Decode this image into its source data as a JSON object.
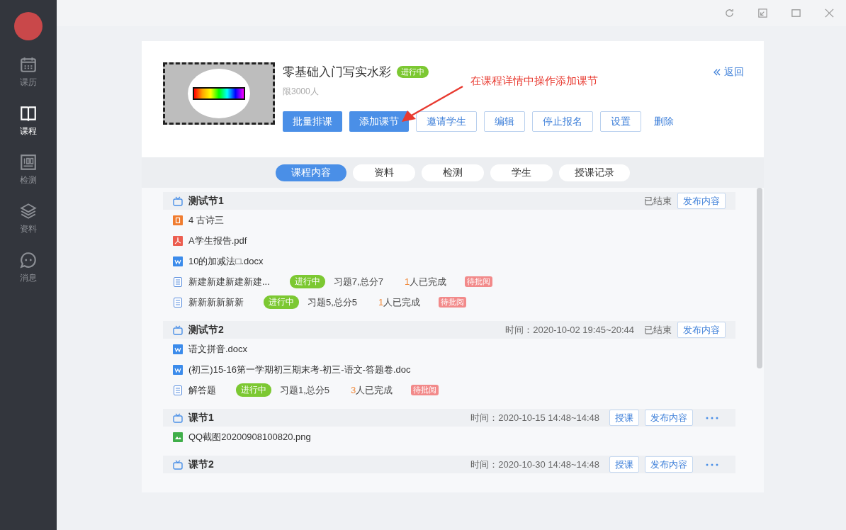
{
  "sidebar": {
    "items": [
      {
        "kind": "calendar",
        "label": "课历",
        "selected": false
      },
      {
        "kind": "book",
        "label": "课程",
        "selected": true
      },
      {
        "kind": "test",
        "label": "检测",
        "selected": false
      },
      {
        "kind": "layers",
        "label": "资料",
        "selected": false
      },
      {
        "kind": "chat",
        "label": "消息",
        "selected": false
      }
    ]
  },
  "course": {
    "title": "零基础入门写实水彩",
    "status": "进行中",
    "limit": "限3000人",
    "back": "返回",
    "buttons": [
      {
        "label": "批量排课",
        "kind": "primary"
      },
      {
        "label": "添加课节",
        "kind": "primary"
      },
      {
        "label": "邀请学生",
        "kind": "outline"
      },
      {
        "label": "编辑",
        "kind": "outline"
      },
      {
        "label": "停止报名",
        "kind": "outline"
      },
      {
        "label": "设置",
        "kind": "outline"
      },
      {
        "label": "删除",
        "kind": "link"
      }
    ],
    "annotation": "在课程详情中操作添加课节"
  },
  "tabs": [
    {
      "label": "课程内容",
      "selected": true
    },
    {
      "label": "资料",
      "selected": false
    },
    {
      "label": "检测",
      "selected": false
    },
    {
      "label": "学生",
      "selected": false
    },
    {
      "label": "授课记录",
      "selected": false
    }
  ],
  "sections": [
    {
      "title": "测试节1",
      "state": "已结束",
      "actions": [
        "发布内容"
      ],
      "more": false,
      "items": [
        {
          "kind": "ppt",
          "name": "4 古诗三"
        },
        {
          "kind": "pdf",
          "name": "A学生报告.pdf"
        },
        {
          "kind": "word",
          "name": "10的加减法□.docx"
        },
        {
          "kind": "quiz",
          "name": "新建新建新建新建...",
          "status": "进行中",
          "info": "习题7,总分7",
          "count": "1",
          "done": "人已完成",
          "review": "待批阅"
        },
        {
          "kind": "quiz",
          "name": "新新新新新新",
          "status": "进行中",
          "info": "习题5,总分5",
          "count": "1",
          "done": "人已完成",
          "review": "待批阅"
        }
      ]
    },
    {
      "title": "测试节2",
      "time": "时间：2020-10-02 19:45~20:44",
      "state": "已结束",
      "actions": [
        "发布内容"
      ],
      "more": false,
      "items": [
        {
          "kind": "word",
          "name": "语文拼音.docx"
        },
        {
          "kind": "word",
          "name": "(初三)15-16第一学期初三期末考-初三-语文-答题卷.doc"
        },
        {
          "kind": "quiz",
          "name": "解答题",
          "status": "进行中",
          "info": "习题1,总分5",
          "count": "3",
          "done": "人已完成",
          "review": "待批阅"
        }
      ]
    },
    {
      "title": "课节1",
      "time": "时间：2020-10-15 14:48~14:48",
      "actions": [
        "授课",
        "发布内容"
      ],
      "more": true,
      "items": [
        {
          "kind": "image",
          "name": "QQ截图20200908100820.png"
        }
      ]
    },
    {
      "title": "课节2",
      "time": "时间：2020-10-30 14:48~14:48",
      "actions": [
        "授课",
        "发布内容"
      ],
      "more": true
    }
  ]
}
